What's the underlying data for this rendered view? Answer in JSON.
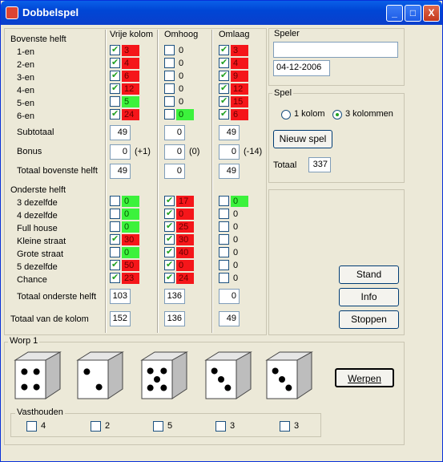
{
  "window": {
    "title": "Dobbelspel",
    "buttons": [
      "_",
      "□",
      "X"
    ]
  },
  "upper": {
    "heading": "Bovenste helft",
    "rows": [
      "1-en",
      "2-en",
      "3-en",
      "4-en",
      "5-en",
      "6-en"
    ],
    "subtotal_label": "Subtotaal",
    "bonus_label": "Bonus",
    "total_label": "Totaal bovenste helft"
  },
  "lower": {
    "heading": "Onderste helft",
    "rows": [
      "3 dezelfde",
      "4 dezelfde",
      "Full house",
      "Kleine straat",
      "Grote straat",
      "5 dezelfde",
      "Chance"
    ],
    "total_label": "Totaal onderste helft"
  },
  "grand_total_label": "Totaal van de kolom",
  "columns": [
    {
      "header": "Vrije kolom",
      "upper": [
        {
          "c": true,
          "v": "3",
          "col": "red"
        },
        {
          "c": true,
          "v": "4",
          "col": "red"
        },
        {
          "c": true,
          "v": "6",
          "col": "red"
        },
        {
          "c": true,
          "v": "12",
          "col": "red"
        },
        {
          "c": false,
          "v": "5",
          "col": "green"
        },
        {
          "c": true,
          "v": "24",
          "col": "red"
        }
      ],
      "subtotal": "49",
      "bonus": "0",
      "bonus_note": "(+1)",
      "total_upper": "49",
      "lower": [
        {
          "c": false,
          "v": "0",
          "col": "green"
        },
        {
          "c": false,
          "v": "0",
          "col": "green"
        },
        {
          "c": false,
          "v": "0",
          "col": "green"
        },
        {
          "c": true,
          "v": "30",
          "col": "red"
        },
        {
          "c": false,
          "v": "0",
          "col": "green"
        },
        {
          "c": true,
          "v": "50",
          "col": "red"
        },
        {
          "c": true,
          "v": "23",
          "col": "red"
        }
      ],
      "total_lower": "103",
      "grand": "152"
    },
    {
      "header": "Omhoog",
      "upper": [
        {
          "c": false,
          "v": "0",
          "col": ""
        },
        {
          "c": false,
          "v": "0",
          "col": ""
        },
        {
          "c": false,
          "v": "0",
          "col": ""
        },
        {
          "c": false,
          "v": "0",
          "col": ""
        },
        {
          "c": false,
          "v": "0",
          "col": ""
        },
        {
          "c": false,
          "v": "0",
          "col": "green"
        }
      ],
      "subtotal": "0",
      "bonus": "0",
      "bonus_note": "(0)",
      "total_upper": "0",
      "lower": [
        {
          "c": true,
          "v": "17",
          "col": "red"
        },
        {
          "c": true,
          "v": "0",
          "col": "red"
        },
        {
          "c": true,
          "v": "25",
          "col": "red"
        },
        {
          "c": true,
          "v": "30",
          "col": "red"
        },
        {
          "c": true,
          "v": "40",
          "col": "red"
        },
        {
          "c": true,
          "v": "0",
          "col": "red"
        },
        {
          "c": true,
          "v": "24",
          "col": "red"
        }
      ],
      "total_lower": "136",
      "grand": "136"
    },
    {
      "header": "Omlaag",
      "upper": [
        {
          "c": true,
          "v": "3",
          "col": "red"
        },
        {
          "c": true,
          "v": "4",
          "col": "red"
        },
        {
          "c": true,
          "v": "9",
          "col": "red"
        },
        {
          "c": true,
          "v": "12",
          "col": "red"
        },
        {
          "c": true,
          "v": "15",
          "col": "red"
        },
        {
          "c": true,
          "v": "6",
          "col": "red"
        }
      ],
      "subtotal": "49",
      "bonus": "0",
      "bonus_note": "(-14)",
      "total_upper": "49",
      "lower": [
        {
          "c": false,
          "v": "0",
          "col": "green"
        },
        {
          "c": false,
          "v": "0",
          "col": ""
        },
        {
          "c": false,
          "v": "0",
          "col": ""
        },
        {
          "c": false,
          "v": "0",
          "col": ""
        },
        {
          "c": false,
          "v": "0",
          "col": ""
        },
        {
          "c": false,
          "v": "0",
          "col": ""
        },
        {
          "c": false,
          "v": "0",
          "col": ""
        }
      ],
      "total_lower": "0",
      "grand": "49"
    }
  ],
  "speler": {
    "title": "Speler",
    "name": "",
    "date": "04-12-2006"
  },
  "spel": {
    "title": "Spel",
    "opt1": "1 kolom",
    "opt2": "3 kolommen",
    "selected": "3 kolommen",
    "new_game": "Nieuw spel",
    "total_label": "Totaal",
    "total": "337"
  },
  "actions": {
    "stand": "Stand",
    "info": "Info",
    "stoppen": "Stoppen"
  },
  "worp": {
    "title": "Worp 1",
    "throw_button": "Werpen",
    "dice": [
      4,
      2,
      5,
      3,
      3
    ]
  },
  "hold": {
    "title": "Vasthouden",
    "values": [
      "4",
      "2",
      "5",
      "3",
      "3"
    ]
  },
  "colors": {
    "red": "#f5161a",
    "green": "#3cf23c",
    "titlebar": "#0046d5"
  }
}
